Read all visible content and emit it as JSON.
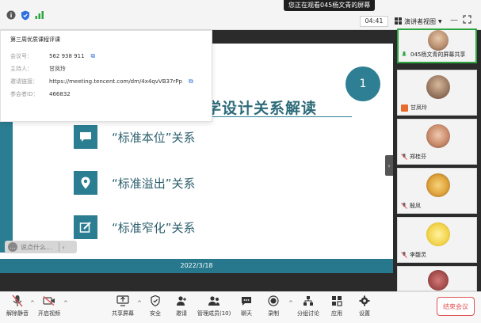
{
  "topbar": {
    "watching_label": "您正在观看045杨文青的屏幕",
    "time": "04:41",
    "view_mode": "演讲者视图",
    "icons": [
      "info-icon",
      "shield-icon",
      "signal-icon",
      "grid-icon",
      "fullscreen-icon"
    ]
  },
  "meeting_info": {
    "title": "第三周优质课程评课",
    "rows": [
      {
        "label": "会议号：",
        "value": "562 938 911",
        "copy": true
      },
      {
        "label": "主持人：",
        "value": "甘凤玲",
        "copy": false
      },
      {
        "label": "邀请链接：",
        "value": "https://meeting.tencent.com/dm/4x4qvVB37rPp",
        "copy": true
      },
      {
        "label": "参会者ID：",
        "value": "466832",
        "copy": false
      }
    ]
  },
  "slide": {
    "page_number": "1",
    "title": "地理课程标准与地理教学设计关系解读",
    "items": [
      {
        "icon": "comment-icon",
        "text": "“标准本位”关系"
      },
      {
        "icon": "location-icon",
        "text": "“标准溢出”关系"
      },
      {
        "icon": "edit-icon",
        "text": "“标准窄化”关系"
      }
    ],
    "date": "2022/3/18"
  },
  "chat_bar": {
    "placeholder": "说点什么..."
  },
  "participants": [
    {
      "name": "045杨文青的屏幕共享",
      "active": true,
      "indicator": "mic"
    },
    {
      "name": "甘凤玲",
      "active": false,
      "indicator": "hand"
    },
    {
      "name": "郑桂芬",
      "active": false,
      "indicator": "mic-muted"
    },
    {
      "name": "殷凤",
      "active": false,
      "indicator": "mic-muted"
    },
    {
      "name": "李馥灵",
      "active": false,
      "indicator": "mic-muted"
    },
    {
      "name": "",
      "active": false,
      "indicator": ""
    }
  ],
  "toolbar": {
    "unmute": "解除静音",
    "video": "开启视频",
    "share": "共享屏幕",
    "security": "安全",
    "invite": "邀请",
    "members": "管理成员(10)",
    "chat": "聊天",
    "record": "录制",
    "breakout": "分组讨论",
    "apps": "应用",
    "settings": "设置",
    "end": "结束会议"
  },
  "colors": {
    "accent_teal": "#2b7d92",
    "active_green": "#2da541",
    "end_red": "#e05252"
  }
}
